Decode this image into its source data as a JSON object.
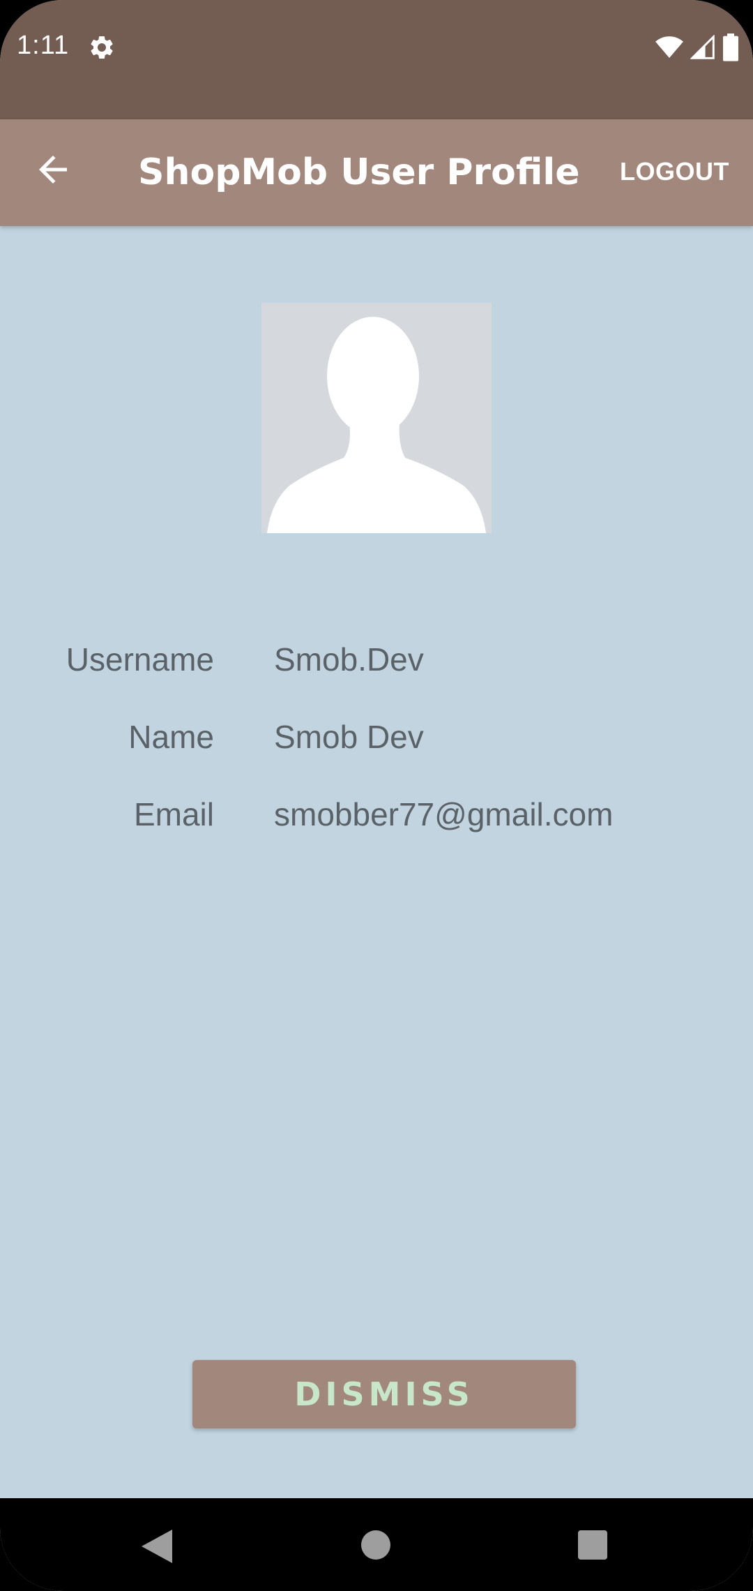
{
  "status_bar": {
    "time": "1:11",
    "icons": [
      "gear-icon",
      "wifi-icon",
      "signal-icon",
      "battery-icon"
    ]
  },
  "app_bar": {
    "title": "ShopMob User Profile",
    "logout_label": "LOGOUT",
    "back_icon": "arrow-left-icon"
  },
  "profile": {
    "avatar_icon": "person-silhouette-icon",
    "fields": [
      {
        "label": "Username",
        "value": "Smob.Dev"
      },
      {
        "label": "Name",
        "value": "Smob Dev"
      },
      {
        "label": "Email",
        "value": "smobber77@gmail.com"
      }
    ]
  },
  "actions": {
    "dismiss_label": "DISMISS"
  },
  "nav_bar": {
    "icons": [
      "nav-back-icon",
      "nav-home-icon",
      "nav-recents-icon"
    ]
  },
  "colors": {
    "status_bar": "#735c52",
    "app_bar": "#a1877c",
    "background": "#c1d4e0",
    "dismiss_text": "#c8e6c9",
    "field_text": "#5a6268"
  }
}
